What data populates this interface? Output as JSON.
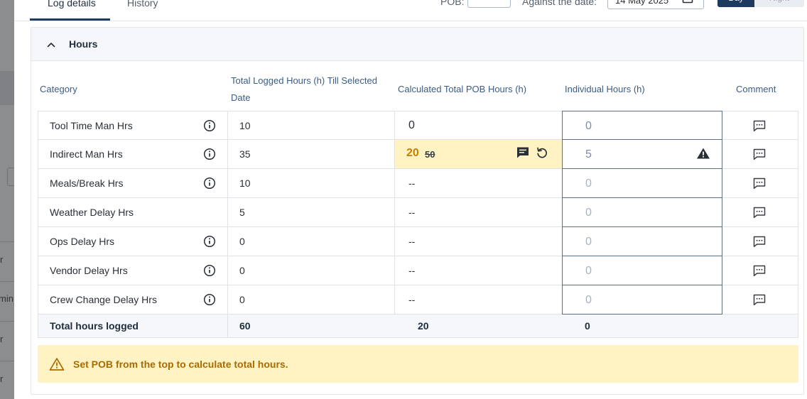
{
  "backdrop": {
    "snippets": [
      "r",
      "min",
      "r",
      "r"
    ]
  },
  "tabs": [
    {
      "label": "Log details",
      "active": true
    },
    {
      "label": "History",
      "active": false
    }
  ],
  "header": {
    "pob_label": "POB:",
    "pob_value": "",
    "date_label": "Against the date:",
    "date_value": "14 May 2025",
    "shift_options": [
      "Day",
      "Night"
    ],
    "shift_selected": "Day"
  },
  "section": {
    "title": "Hours",
    "expanded": true
  },
  "columns": {
    "category": "Category",
    "logged": "Total Logged Hours (h) Till Selected Date",
    "calculated": "Calculated Total POB Hours (h)",
    "individual": "Individual Hours (h)",
    "comment": "Comment"
  },
  "rows": [
    {
      "category": "Tool Time Man Hrs",
      "info": true,
      "logged": "10",
      "calculated": "0",
      "individual": "0"
    },
    {
      "category": "Indirect Man Hrs",
      "info": true,
      "logged": "35",
      "calculated_new": "20",
      "calculated_old": "50",
      "individual": "5",
      "highlight": true
    },
    {
      "category": "Meals/Break Hrs",
      "info": true,
      "logged": "10",
      "calculated": "--",
      "individual": "0"
    },
    {
      "category": "Weather Delay Hrs",
      "info": false,
      "logged": "5",
      "calculated": "--",
      "individual": "0"
    },
    {
      "category": "Ops Delay Hrs",
      "info": true,
      "logged": "0",
      "calculated": "--",
      "individual": "0"
    },
    {
      "category": "Vendor Delay Hrs",
      "info": true,
      "logged": "0",
      "calculated": "--",
      "individual": "0"
    },
    {
      "category": "Crew Change Delay Hrs",
      "info": true,
      "logged": "0",
      "calculated": "--",
      "individual": "0"
    }
  ],
  "totals": {
    "label": "Total hours logged",
    "logged": "60",
    "calculated": "20",
    "individual": "0"
  },
  "alert": {
    "text": "Set POB from the top to calculate total hours."
  },
  "colors": {
    "accent": "#1f3a5f",
    "warning_bg": "#fff3c4",
    "warning_text": "#a86b00",
    "header_text": "#3a5d86"
  },
  "icons": {
    "info": "info-circle-icon",
    "comment": "comment-bubble-icon",
    "note": "note-icon",
    "reset": "reset-icon",
    "warning": "warning-triangle-icon",
    "calendar": "calendar-icon",
    "chevron": "chevron-up-icon"
  }
}
